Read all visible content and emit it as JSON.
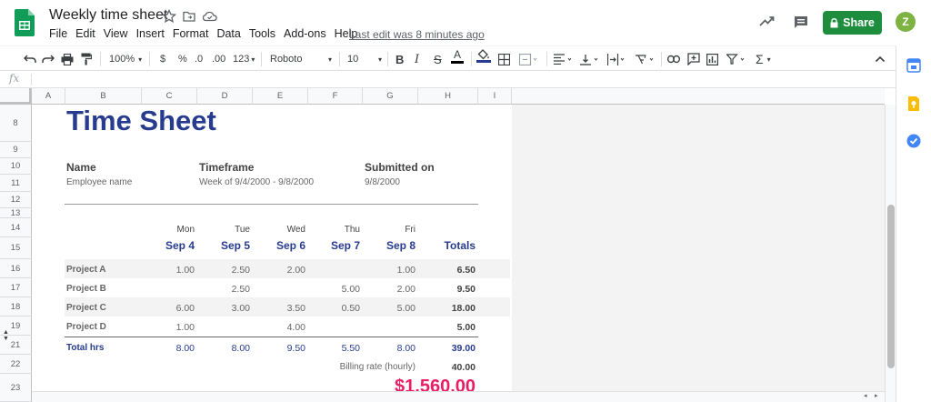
{
  "app": {
    "title": "Weekly time sheet",
    "last_edit": "Last edit was 8 minutes ago",
    "share_label": "Share",
    "avatar_letter": "Z"
  },
  "menu": [
    "File",
    "Edit",
    "View",
    "Insert",
    "Format",
    "Data",
    "Tools",
    "Add-ons",
    "Help"
  ],
  "toolbar": {
    "zoom": "100%",
    "currency": "$",
    "percent": "%",
    "dec_less": ".0",
    "dec_more": ".00",
    "more_formats": "123",
    "font": "Roboto",
    "font_size": "10",
    "bold": "B",
    "italic": "I",
    "strike": "S",
    "text_color": "A",
    "text_color_swatch": "#000000",
    "fill_swatch": "#273c8f"
  },
  "formula_bar": {
    "fx": "fx",
    "value": ""
  },
  "columns": [
    "A",
    "B",
    "C",
    "D",
    "E",
    "F",
    "G",
    "H",
    "I"
  ],
  "rows": [
    "8",
    "9",
    "10",
    "11",
    "12",
    "13",
    "14",
    "15",
    "16",
    "17",
    "18",
    "19",
    "21",
    "22",
    "23"
  ],
  "sheet": {
    "title": "Time Sheet",
    "name_label": "Name",
    "name_value": "Employee name",
    "timeframe_label": "Timeframe",
    "timeframe_value": "Week of 9/4/2000 - 9/8/2000",
    "submitted_label": "Submitted on",
    "submitted_value": "9/8/2000",
    "days": [
      {
        "day": "Mon",
        "date": "Sep 4"
      },
      {
        "day": "Tue",
        "date": "Sep 5"
      },
      {
        "day": "Wed",
        "date": "Sep 6"
      },
      {
        "day": "Thu",
        "date": "Sep 7"
      },
      {
        "day": "Fri",
        "date": "Sep 8"
      }
    ],
    "totals_label": "Totals",
    "projects": [
      {
        "name": "Project A",
        "hours": [
          "1.00",
          "2.50",
          "2.00",
          "",
          "1.00"
        ],
        "total": "6.50"
      },
      {
        "name": "Project B",
        "hours": [
          "",
          "2.50",
          "",
          "5.00",
          "2.00"
        ],
        "total": "9.50"
      },
      {
        "name": "Project C",
        "hours": [
          "6.00",
          "3.00",
          "3.50",
          "0.50",
          "5.00"
        ],
        "total": "18.00"
      },
      {
        "name": "Project D",
        "hours": [
          "1.00",
          "",
          "4.00",
          "",
          ""
        ],
        "total": "5.00"
      }
    ],
    "total_hrs_label": "Total hrs",
    "total_hrs": [
      "8.00",
      "8.00",
      "9.50",
      "5.50",
      "8.00"
    ],
    "total_hrs_sum": "39.00",
    "billing_label": "Billing rate (hourly)",
    "billing_value": "40.00",
    "amount": "$1,560.00"
  },
  "colors": {
    "accent_blue": "#273c8f",
    "share_green": "#1e8e3e",
    "amount_pink": "#e91e63",
    "band_gray": "#f3f3f3"
  }
}
